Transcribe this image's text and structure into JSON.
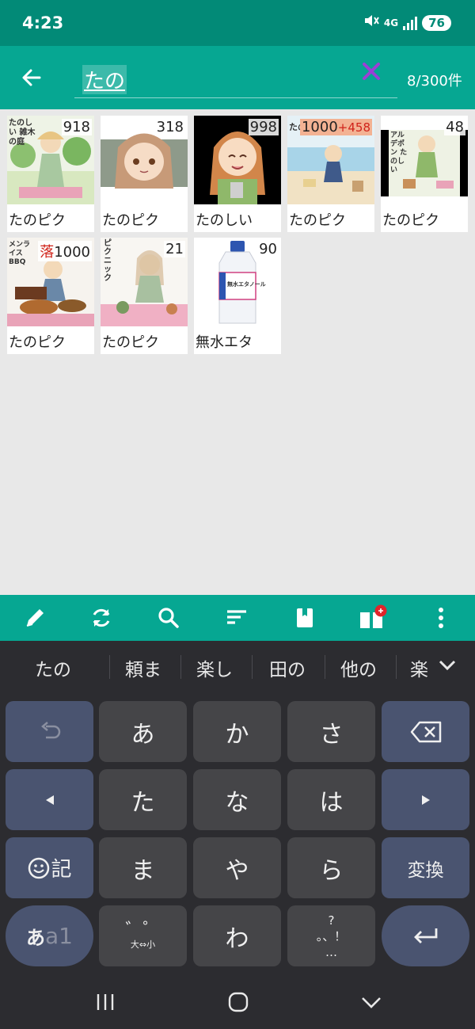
{
  "status": {
    "time": "4:23",
    "network": "4G",
    "battery": "76"
  },
  "appbar": {
    "query": "たの",
    "count": "8/300件"
  },
  "items": [
    {
      "num": "918",
      "label": "たのピク"
    },
    {
      "num": "318",
      "label": "たのピク"
    },
    {
      "num": "998",
      "label": "たのしい"
    },
    {
      "num": "1000",
      "num_extra": "+458",
      "label": "たのピク"
    },
    {
      "num": "48",
      "label": "たのピク"
    },
    {
      "num_prefix": "落",
      "num": "1000",
      "label": "たのピク"
    },
    {
      "num": "21",
      "label": "たのピク"
    },
    {
      "num": "90",
      "label": "無水エタ"
    }
  ],
  "thumb_text": {
    "card1": "たのしい 雑木の庭",
    "card4": "たの海",
    "card5": "アルデポン たのしい",
    "card6": "メンライス BBQ",
    "card7": "ピクニック",
    "card8": "無水エタノール"
  },
  "toolbar": {
    "icons": [
      "pencil-icon",
      "refresh-icon",
      "search-icon",
      "sort-icon",
      "book-icon",
      "gift-icon",
      "more-icon"
    ]
  },
  "keyboard": {
    "candidates": [
      "たの",
      "頼ま",
      "楽し",
      "田の",
      "他の",
      "楽"
    ],
    "keys": {
      "a": "あ",
      "ka": "か",
      "sa": "さ",
      "ta": "た",
      "na": "な",
      "ha": "は",
      "ma": "ま",
      "ya": "や",
      "ra": "ら",
      "wa": "わ",
      "emoji_label": "記",
      "convert": "変換",
      "mode_kana": "あ",
      "mode_alpha": "a1",
      "dakuten_label": "大⇔小",
      "punct_top": "?",
      "punct_mid": "。、！",
      "punct_bottom": "…"
    }
  },
  "colors": {
    "status": "#028a77",
    "appbar": "#06a792",
    "keyboard": "#2c2c30",
    "fnkey": "#4a5470",
    "clear": "#9b3fd6"
  }
}
